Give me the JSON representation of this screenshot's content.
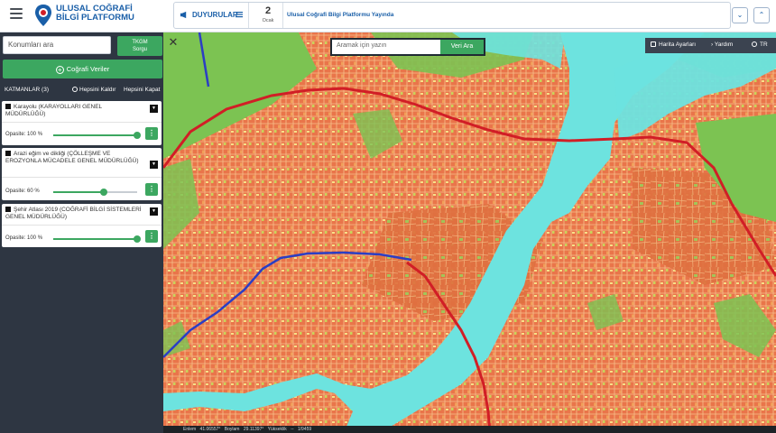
{
  "header": {
    "brand_line1": "ULUSAL COĞRAFİ",
    "brand_line2": "BİLGİ PLATFORMU",
    "announcements": {
      "title": "DUYURULAR",
      "day": "2",
      "month": "Ocak",
      "text": "Ulusal Coğrafi Bilgi Platformu Yayında"
    },
    "icons": {
      "menu": "hamburger-icon",
      "logo": "location-pin-logo",
      "announce": "megaphone-icon",
      "list": "list-icon",
      "down": "chevron-down-icon",
      "up": "chevron-up-icon"
    }
  },
  "sidebar": {
    "search_placeholder": "Konumları ara",
    "tkgm_line1": "TKGM",
    "tkgm_line2": "Sorgu",
    "geo_button": "Coğrafi Veriler",
    "layers_title": "KATMANLAR (3)",
    "hide_all": "Hepsini Kaldır",
    "close_all": "Hepsini Kapat",
    "layers": [
      {
        "name": "Karayolu (KARAYOLLARI GENEL MÜDÜRLÜĞÜ)",
        "opacity_label": "Opasite: 100 %",
        "opacity": 100
      },
      {
        "name": "Arazi eğim ve dikliği (ÇÖLLEŞME VE EROZYONLA MÜCADELE GENEL MÜDÜRLÜĞÜ)",
        "opacity_label": "Opasite: 60 %",
        "opacity": 60
      },
      {
        "name": "Şehir Atlası 2019 (COĞRAFİ BİLGİ SİSTEMLERİ GENEL MÜDÜRLÜĞÜ)",
        "opacity_label": "Opasite: 100 %",
        "opacity": 100
      }
    ]
  },
  "map": {
    "search_placeholder": "Aramak için yazın",
    "search_button": "Veri Ara",
    "tools": {
      "settings": "Harita Ayarları",
      "help": "Yardım",
      "lang": "TR"
    },
    "status": "Enlem 41.06557° Boylam 29.11397° Yükseklik -- 1/9459",
    "colors": {
      "water": "#6de3df",
      "urban": "#e9754a",
      "green": "#7cc352",
      "road_red": "#d11e26",
      "road_blue": "#2b3ec4"
    }
  }
}
